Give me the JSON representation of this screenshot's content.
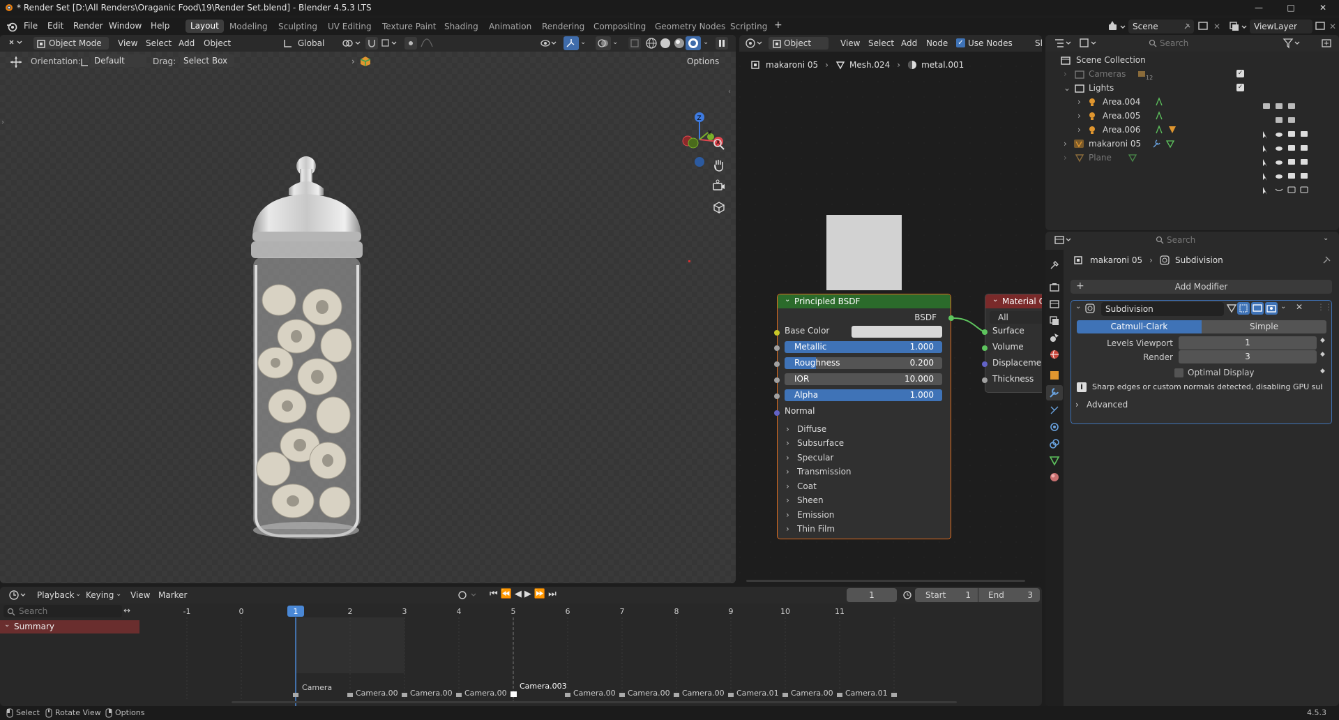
{
  "window": {
    "title": "* Render Set [D:\\All Renders\\Oraganic Food\\19\\Render Set.blend] - Blender 4.5.3 LTS",
    "version": "4.5.3"
  },
  "menu": [
    "File",
    "Edit",
    "Render",
    "Window",
    "Help"
  ],
  "workspaces": [
    "Layout",
    "Modeling",
    "Sculpting",
    "UV Editing",
    "Texture Paint",
    "Shading",
    "Animation",
    "Rendering",
    "Compositing",
    "Geometry Nodes",
    "Scripting"
  ],
  "active_workspace": "Layout",
  "scene": {
    "scene_name": "Scene",
    "view_layer": "ViewLayer"
  },
  "viewport": {
    "mode": "Object Mode",
    "menus": [
      "View",
      "Select",
      "Add",
      "Object"
    ],
    "transform": "Global",
    "orientation_label": "Orientation:",
    "orientation": "Default",
    "drag_label": "Drag:",
    "drag": "Select Box",
    "options": "Options",
    "gizmo": {
      "x": "X",
      "y": "Y",
      "z": "Z"
    }
  },
  "node_editor": {
    "type": "Object",
    "menus": [
      "View",
      "Select",
      "Add",
      "Node"
    ],
    "use_nodes": "Use Nodes",
    "breadcrumb": [
      "makaroni 05",
      "Mesh.024",
      "metal.001"
    ],
    "bsdf": {
      "title": "Principled BSDF",
      "output": "BSDF",
      "base_color_label": "Base Color",
      "sliders": [
        {
          "label": "Metallic",
          "value": "1.000",
          "fill": 1.0
        },
        {
          "label": "Roughness",
          "value": "0.200",
          "fill": 0.2
        },
        {
          "label": "IOR",
          "value": "10.000",
          "fill": 0.0
        },
        {
          "label": "Alpha",
          "value": "1.000",
          "fill": 1.0
        }
      ],
      "normal": "Normal",
      "panels": [
        "Diffuse",
        "Subsurface",
        "Specular",
        "Transmission",
        "Coat",
        "Sheen",
        "Emission",
        "Thin Film"
      ]
    },
    "output_node": {
      "title": "Material Ou",
      "target": "All",
      "inputs": [
        "Surface",
        "Volume",
        "Displacemen",
        "Thickness"
      ]
    }
  },
  "outliner": {
    "search_placeholder": "Search",
    "root": "Scene Collection",
    "items": [
      {
        "name": "Cameras",
        "extra": "12",
        "dim": true
      },
      {
        "name": "Lights",
        "dim": false
      },
      {
        "name": "Area.004",
        "dim": false
      },
      {
        "name": "Area.005",
        "dim": false
      },
      {
        "name": "Area.006",
        "dim": false
      },
      {
        "name": "makaroni 05",
        "dim": false
      },
      {
        "name": "Plane",
        "dim": true
      }
    ]
  },
  "properties": {
    "search_placeholder": "Search",
    "breadcrumb": [
      "makaroni 05",
      "Subdivision"
    ],
    "add_modifier": "Add Modifier",
    "modifier": {
      "name": "Subdivision",
      "types": [
        "Catmull-Clark",
        "Simple"
      ],
      "active_type": "Catmull-Clark",
      "levels_viewport_label": "Levels Viewport",
      "levels_viewport": "1",
      "render_label": "Render",
      "render": "3",
      "optimal_display": "Optimal Display",
      "warning": "Sharp edges or custom normals detected, disabling GPU sub...",
      "advanced": "Advanced"
    }
  },
  "timeline": {
    "menus": [
      "Playback",
      "Keying",
      "View",
      "Marker"
    ],
    "current_frame": "1",
    "start_label": "Start",
    "start": "1",
    "end_label": "End",
    "end": "3",
    "search_placeholder": "Search",
    "summary": "Summary",
    "ruler": [
      "-1",
      "0",
      "1",
      "2",
      "3",
      "4",
      "5",
      "6",
      "7",
      "8",
      "9",
      "10",
      "11"
    ],
    "markers": [
      "Camera",
      "Camera.00",
      "Camera.00",
      "Camera.00",
      "Camera.003",
      "Camera.00",
      "Camera.00",
      "Camera.00",
      "Camera.01",
      "Camera.00",
      "Camera.01"
    ]
  },
  "status": {
    "select": "Select",
    "rotate": "Rotate View",
    "options": "Options",
    "version": "4.5.3"
  }
}
